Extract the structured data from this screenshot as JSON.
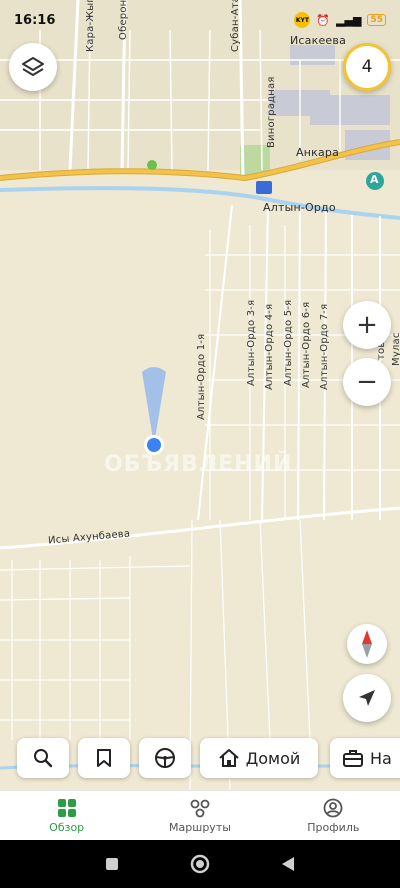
{
  "status_bar": {
    "time": "16:16",
    "operator_badge": "KYT",
    "battery": "55"
  },
  "map": {
    "street_labels": {
      "kara_zhygach": "Кара-Жыгач",
      "oberon": "Оберон",
      "suban_ata": "Субан-Ата",
      "isakeeva": "Исакеева",
      "vinogradnaya": "Виноградная",
      "ankara": "Анкара",
      "altyn_ordo": "Алтын-Ордо",
      "altyn_ordo_1": "Алтын-Ордо 1-я",
      "altyn_ordo_3": "Алтын-Ордо 3-я",
      "altyn_ordo_4": "Алтын-Ордо 4-я",
      "altyn_ordo_5": "Алтын-Ордо 5-я",
      "altyn_ordo_6": "Алтын-Ордо 6-я",
      "altyn_ordo_7": "Алтын-Ордо 7-я",
      "isy_akhunbaeva": "Исы Ахунбаева",
      "tovo": "тово",
      "mulas": "Мулас"
    },
    "watermark": "ОБЪЯВЛЕНИЙ",
    "poi_letter": "A"
  },
  "controls": {
    "badge_count": "4",
    "zoom_in": "+",
    "zoom_out": "−"
  },
  "quick_actions": {
    "home_label": "Домой",
    "work_label": "На"
  },
  "bottom_nav": {
    "items": [
      {
        "label": "Обзор",
        "icon": "grid-icon",
        "active": true
      },
      {
        "label": "Маршруты",
        "icon": "routes-icon",
        "active": false
      },
      {
        "label": "Профиль",
        "icon": "profile-icon",
        "active": false
      }
    ]
  },
  "colors": {
    "accent": "#2e9b47",
    "highway": "#f2c24a",
    "water": "#a9d3ef",
    "badge_ring": "#f4c430"
  }
}
